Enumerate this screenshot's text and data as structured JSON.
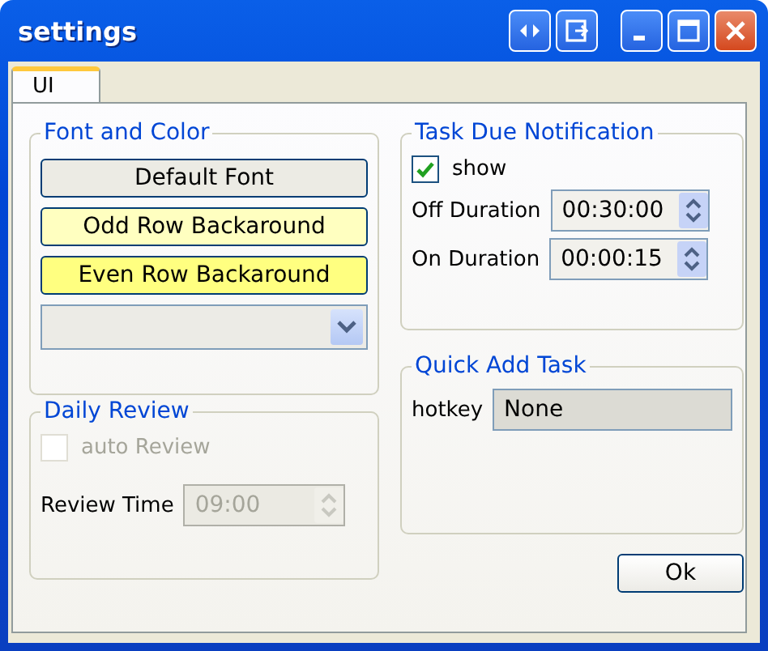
{
  "window": {
    "title": "settings"
  },
  "tabs": [
    {
      "label": "UI",
      "selected": true
    }
  ],
  "font_and_color": {
    "title": "Font and Color",
    "buttons": [
      {
        "label": "Default Font",
        "color": "#ecebe4"
      },
      {
        "label": "Odd Row Backaround",
        "color": "#ffffc0"
      },
      {
        "label": "Even Row Backaround",
        "color": "#ffff80"
      }
    ]
  },
  "daily_review": {
    "title": "Daily Review",
    "auto_review": {
      "label": "auto Review",
      "checked": false,
      "disabled": true
    },
    "review_time": {
      "label": "Review Time",
      "value": "09:00",
      "disabled": true
    }
  },
  "task_due_notification": {
    "title": "Task Due Notification",
    "show": {
      "label": "show",
      "checked": true,
      "disabled": false
    },
    "fields": [
      {
        "label": "Off Duration",
        "value": "00:30:00"
      },
      {
        "label": "On Duration",
        "value": "00:00:15"
      }
    ]
  },
  "quick_add_task": {
    "title": "Quick Add Task",
    "hotkey": {
      "label": "hotkey",
      "value": "None"
    }
  },
  "ok_button": "Ok"
}
